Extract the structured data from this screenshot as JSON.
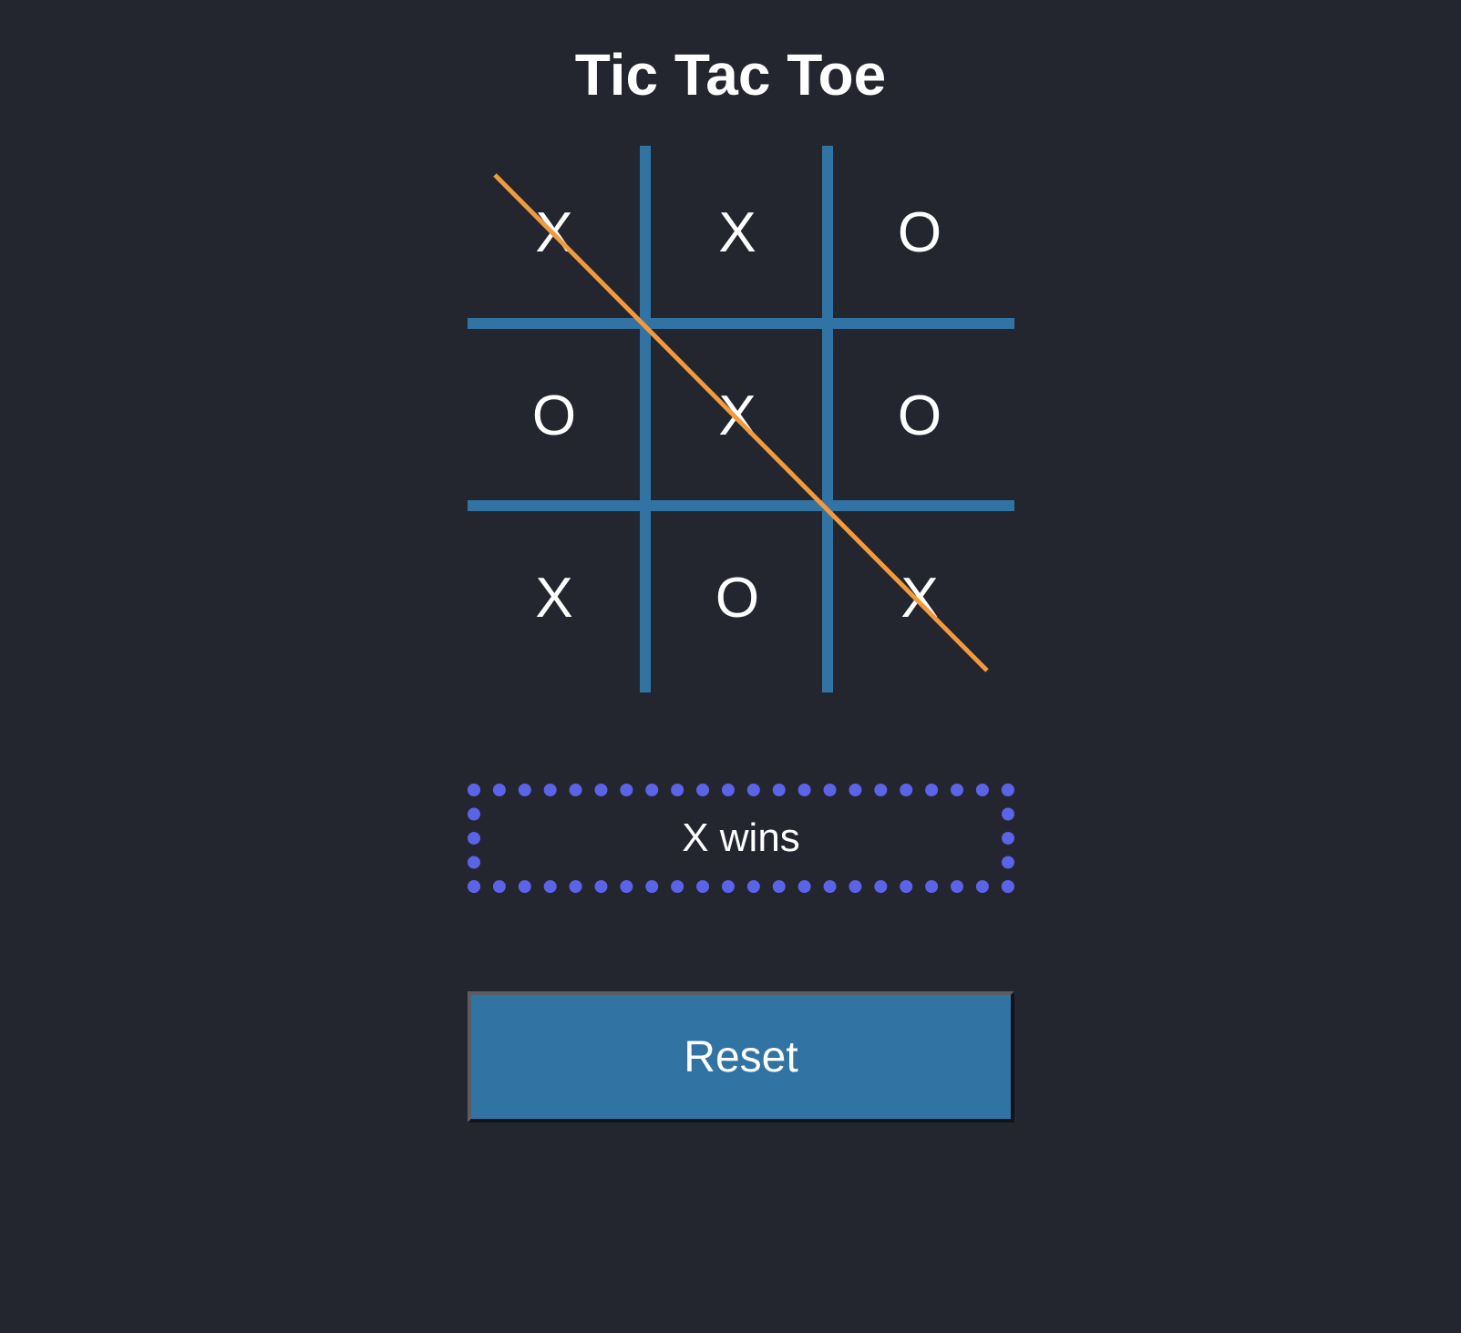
{
  "title": "Tic Tac Toe",
  "board": {
    "cells": [
      "X",
      "X",
      "O",
      "O",
      "X",
      "O",
      "X",
      "O",
      "X"
    ],
    "winning_line": "diagonal-top-left-to-bottom-right"
  },
  "status": "X wins",
  "reset_label": "Reset",
  "colors": {
    "background": "#23262f",
    "grid": "#3173a3",
    "win_line": "#f39a3c",
    "status_border": "#5b63e8",
    "button": "#3173a3",
    "text": "#ffffff"
  }
}
